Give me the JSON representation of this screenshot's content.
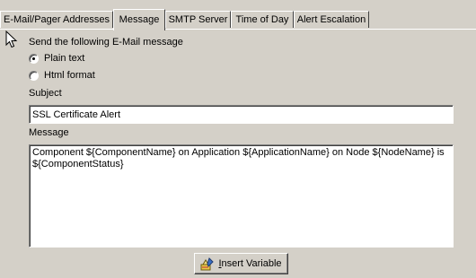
{
  "tabs": [
    {
      "label": "E-Mail/Pager Addresses",
      "active": false
    },
    {
      "label": "Message",
      "active": true
    },
    {
      "label": "SMTP Server",
      "active": false
    },
    {
      "label": "Time of Day",
      "active": false
    },
    {
      "label": "Alert Escalation",
      "active": false
    }
  ],
  "form": {
    "heading": "Send the following E-Mail message",
    "format_options": [
      {
        "label": "Plain text",
        "selected": true
      },
      {
        "label": "Html format",
        "selected": false
      }
    ],
    "subject_label": "Subject",
    "subject_value": "SSL Certificate Alert",
    "message_label": "Message",
    "message_value": "Component ${ComponentName} on Application ${ApplicationName} on Node ${NodeName} is ${ComponentStatus}"
  },
  "insert_button": {
    "label_accel": "I",
    "label_rest": "nsert Variable",
    "icon": "insert-variable-icon"
  },
  "cursor": {
    "icon": "mouse-pointer-icon"
  }
}
